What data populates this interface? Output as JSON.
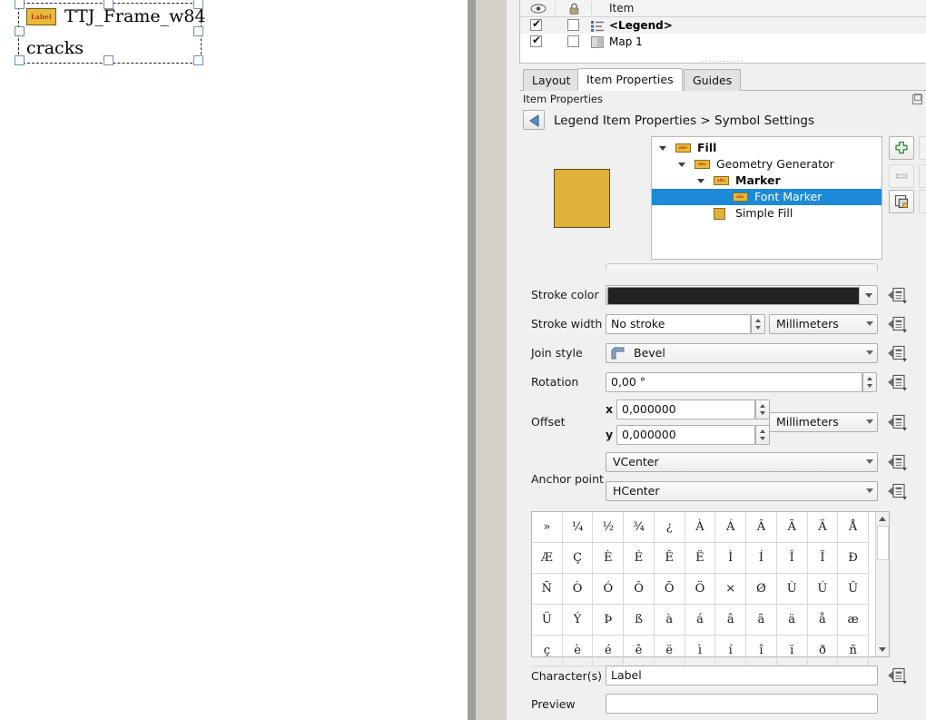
{
  "canvas": {
    "legend_item": {
      "swatch_text": "Label",
      "title": "TTJ_Frame_w84",
      "subtitle": "cracks"
    }
  },
  "items_panel": {
    "columns": {
      "visible_icon": "eye-icon",
      "lock_icon": "lock-icon",
      "item": "Item"
    },
    "rows": [
      {
        "label": "<Legend>",
        "checked": true,
        "locked": false,
        "selected": true,
        "icon": "legend-icon"
      },
      {
        "label": "Map 1",
        "checked": true,
        "locked": false,
        "selected": false,
        "icon": "map-icon"
      }
    ]
  },
  "tabs": [
    {
      "label": "Layout",
      "active": false
    },
    {
      "label": "Item Properties",
      "active": true
    },
    {
      "label": "Guides",
      "active": false
    }
  ],
  "panel_header": {
    "title": "Item Properties",
    "dock_icon": "float-dock-icon"
  },
  "breadcrumb": {
    "back_icon": "back-arrow-icon",
    "text": "Legend Item Properties > Symbol Settings"
  },
  "symbol": {
    "preview_color": "#e0b13a",
    "tree": [
      {
        "label": "Fill",
        "depth": 0,
        "bold": true,
        "expanded": true,
        "icon": "label-marker-icon",
        "selected": false
      },
      {
        "label": "Geometry Generator",
        "depth": 1,
        "bold": false,
        "expanded": true,
        "icon": "label-marker-icon",
        "selected": false
      },
      {
        "label": "Marker",
        "depth": 2,
        "bold": true,
        "expanded": true,
        "icon": "label-marker-icon",
        "selected": false
      },
      {
        "label": "Font Marker",
        "depth": 3,
        "bold": false,
        "expanded": false,
        "icon": "label-marker-icon",
        "selected": true
      },
      {
        "label": "Simple Fill",
        "depth": 2,
        "bold": false,
        "expanded": false,
        "icon": "fill-swatch-icon",
        "selected": false
      }
    ],
    "tools": [
      {
        "name": "add-symbol-layer-button",
        "icon": "plus-icon",
        "enabled": true
      },
      {
        "name": "remove-symbol-layer-button",
        "icon": "minus-icon",
        "enabled": false
      },
      {
        "name": "duplicate-layer-button",
        "icon": "duplicate-icon",
        "enabled": true
      },
      {
        "name": "move-up-button",
        "icon": "up-arrow-icon",
        "enabled": false
      },
      {
        "name": "move-down-button",
        "icon": "down-arrow-icon",
        "enabled": false
      },
      {
        "name": "lock-layer-button",
        "icon": "lock-icon",
        "enabled": false
      }
    ]
  },
  "form": {
    "stroke_color": {
      "label": "Stroke color",
      "value": "",
      "swatch": "#232323"
    },
    "stroke_width": {
      "label": "Stroke width",
      "value": "No stroke",
      "unit": "Millimeters"
    },
    "join_style": {
      "label": "Join style",
      "value": "Bevel"
    },
    "rotation": {
      "label": "Rotation",
      "value": "0,00 °"
    },
    "offset": {
      "label": "Offset",
      "x_label": "x",
      "x_value": "0,000000",
      "y_label": "y",
      "y_value": "0,000000",
      "unit": "Millimeters"
    },
    "anchor_point": {
      "label": "Anchor point",
      "vertical": "VCenter",
      "horizontal": "HCenter"
    },
    "characters": {
      "label": "Character(s)",
      "value": "Label"
    },
    "preview": {
      "label": "Preview",
      "value": ""
    },
    "override_icon": "data-defined-override-icon"
  },
  "char_grid": {
    "columns": 11,
    "rows": [
      [
        "»",
        "¼",
        "½",
        "¾",
        "¿",
        "À",
        "Á",
        "Â",
        "Ã",
        "Ä",
        "Å"
      ],
      [
        "Æ",
        "Ç",
        "È",
        "É",
        "Ê",
        "Ë",
        "Ì",
        "Í",
        "Î",
        "Ï",
        "Ð"
      ],
      [
        "Ñ",
        "Ò",
        "Ó",
        "Ô",
        "Õ",
        "Ö",
        "×",
        "Ø",
        "Ù",
        "Ú",
        "Û"
      ],
      [
        "Ü",
        "Ý",
        "Þ",
        "ß",
        "à",
        "á",
        "â",
        "ã",
        "ä",
        "å",
        "æ"
      ],
      [
        "ç",
        "è",
        "é",
        "ê",
        "ë",
        "ì",
        "í",
        "î",
        "ï",
        "ð",
        "ñ"
      ]
    ]
  }
}
